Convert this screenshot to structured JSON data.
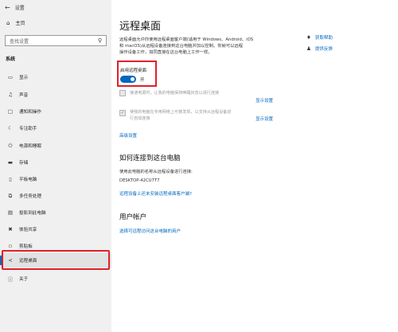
{
  "window": {
    "title": "设置",
    "back_icon": "back-arrow-icon"
  },
  "sidebar": {
    "home": "主页",
    "search_placeholder": "查找设置",
    "section": "系统",
    "items": [
      {
        "label": "显示",
        "icon": "monitor-icon"
      },
      {
        "label": "声音",
        "icon": "speaker-icon"
      },
      {
        "label": "通知和操作",
        "icon": "notification-icon"
      },
      {
        "label": "专注助手",
        "icon": "moon-icon"
      },
      {
        "label": "电源和睡眠",
        "icon": "power-icon"
      },
      {
        "label": "存储",
        "icon": "storage-icon"
      },
      {
        "label": "平板电脑",
        "icon": "tablet-icon"
      },
      {
        "label": "多任务处理",
        "icon": "multitask-icon"
      },
      {
        "label": "投影到此电脑",
        "icon": "projector-icon"
      },
      {
        "label": "体验共享",
        "icon": "share-icon"
      },
      {
        "label": "剪贴板",
        "icon": "clipboard-icon"
      },
      {
        "label": "远程桌面",
        "icon": "remote-desktop-icon"
      },
      {
        "label": "关于",
        "icon": "info-icon"
      }
    ],
    "active_index": 11
  },
  "main": {
    "title": "远程桌面",
    "intro_lines": [
      "远程桌面允许你使用远程桌面客户端(适用于 Windows、Android、iOS",
      "和 macOS)从远程设备连接到这台电脑并加以控制。你就可以远程",
      "操作设备工作，如同直接在这台电脑上工作一样。"
    ],
    "toggle": {
      "label": "启用远程桌面",
      "state": "开",
      "on": true
    },
    "option1": {
      "lines": [
        "接通电源时，让我的电脑保持唤醒状态以进行连接"
      ],
      "link": "显示设置"
    },
    "option2": {
      "lines": [
        "使我的电脑在专用网络上可被发现，以支持从远程设备进",
        "行自动连接"
      ],
      "link": "显示设置"
    },
    "advanced_link": "高级设置",
    "how_to": {
      "heading": "如何连接到这台电脑",
      "text": "使用此电脑的名称从远程设备进行连接:",
      "pc_name": "DESKTOP-42CU7T7",
      "link": "远程设备上还未安装远程桌面客户端?"
    },
    "user_accounts": {
      "heading": "用户帐户",
      "link": "选择可远程访问这台电脑的用户"
    },
    "help": [
      {
        "label": "获取帮助",
        "icon": "help-chat-icon"
      },
      {
        "label": "提供反馈",
        "icon": "feedback-icon"
      }
    ],
    "accent_color": "#0067c0",
    "highlight_color": "#e0202a"
  }
}
